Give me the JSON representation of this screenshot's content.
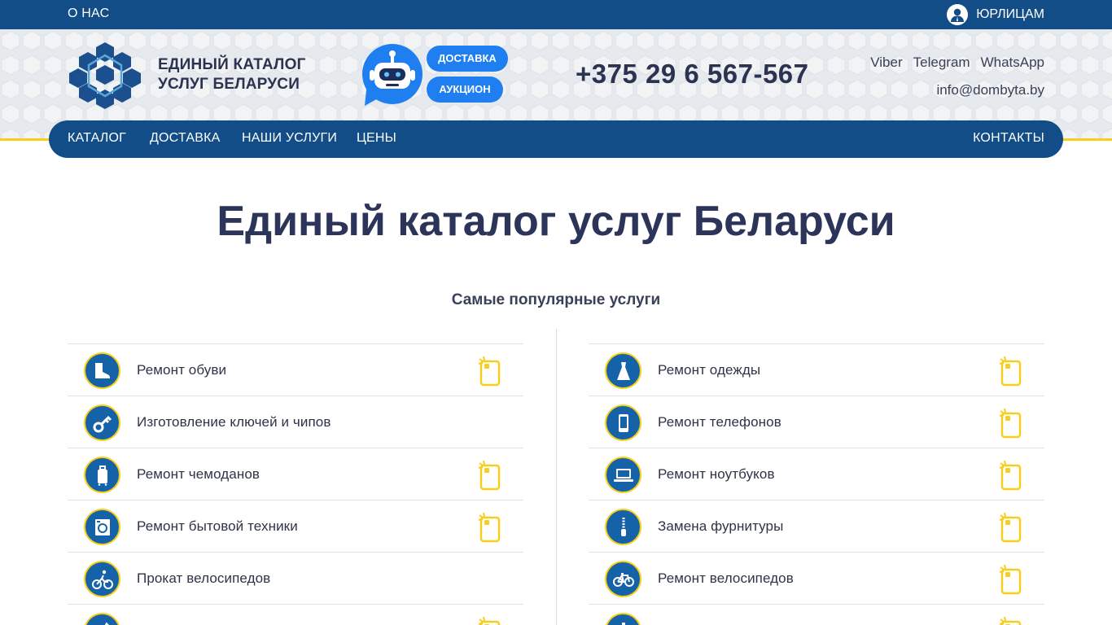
{
  "topbar": {
    "about": "О НАС",
    "legal": "ЮРЛИЦАМ",
    "legal_icon": "user-icon"
  },
  "header": {
    "brand_line1": "ЕДИНЫЙ КАТАЛОГ",
    "brand_line2": "УСЛУГ БЕЛАРУСИ",
    "bot_icon": "robot-icon",
    "delivery_pill": "ДОСТАВКА",
    "auction_pill": "АУКЦИОН",
    "phone": "+375 29 6 567-567",
    "messengers": [
      "Viber",
      "Telegram",
      "WhatsApp"
    ],
    "email": "info@dombyta.by"
  },
  "nav": {
    "items": [
      "КАТАЛОГ",
      "ДОСТАВКА",
      "НАШИ УСЛУГИ",
      "ЦЕНЫ"
    ],
    "contacts": "КОНТАКТЫ"
  },
  "main": {
    "title": "Единый каталог услуг Беларуси",
    "subtitle": "Самые популярные услуги"
  },
  "services_left": [
    {
      "label": "Ремонт обуви",
      "icon": "boot-icon",
      "tap": true
    },
    {
      "label": "Изготовление ключей и чипов",
      "icon": "key-icon",
      "tap": false
    },
    {
      "label": "Ремонт чемоданов",
      "icon": "suitcase-icon",
      "tap": true
    },
    {
      "label": "Ремонт бытовой техники",
      "icon": "washing-machine-icon",
      "tap": true
    },
    {
      "label": "Прокат велосипедов",
      "icon": "cyclist-icon",
      "tap": false
    },
    {
      "label": "",
      "icon": "tool-icon",
      "tap": true
    }
  ],
  "services_right": [
    {
      "label": "Ремонт одежды",
      "icon": "dress-icon",
      "tap": true
    },
    {
      "label": "Ремонт телефонов",
      "icon": "phone-icon",
      "tap": true
    },
    {
      "label": "Ремонт ноутбуков",
      "icon": "laptop-icon",
      "tap": true
    },
    {
      "label": "Замена фурнитуры",
      "icon": "zipper-icon",
      "tap": true
    },
    {
      "label": "Ремонт велосипедов",
      "icon": "bicycle-icon",
      "tap": true
    },
    {
      "label": "",
      "icon": "faucet-icon",
      "tap": true
    }
  ],
  "colors": {
    "primary": "#124d87",
    "accent": "#f5cf1a",
    "pill": "#1f7ff0",
    "text": "#2c3459"
  }
}
